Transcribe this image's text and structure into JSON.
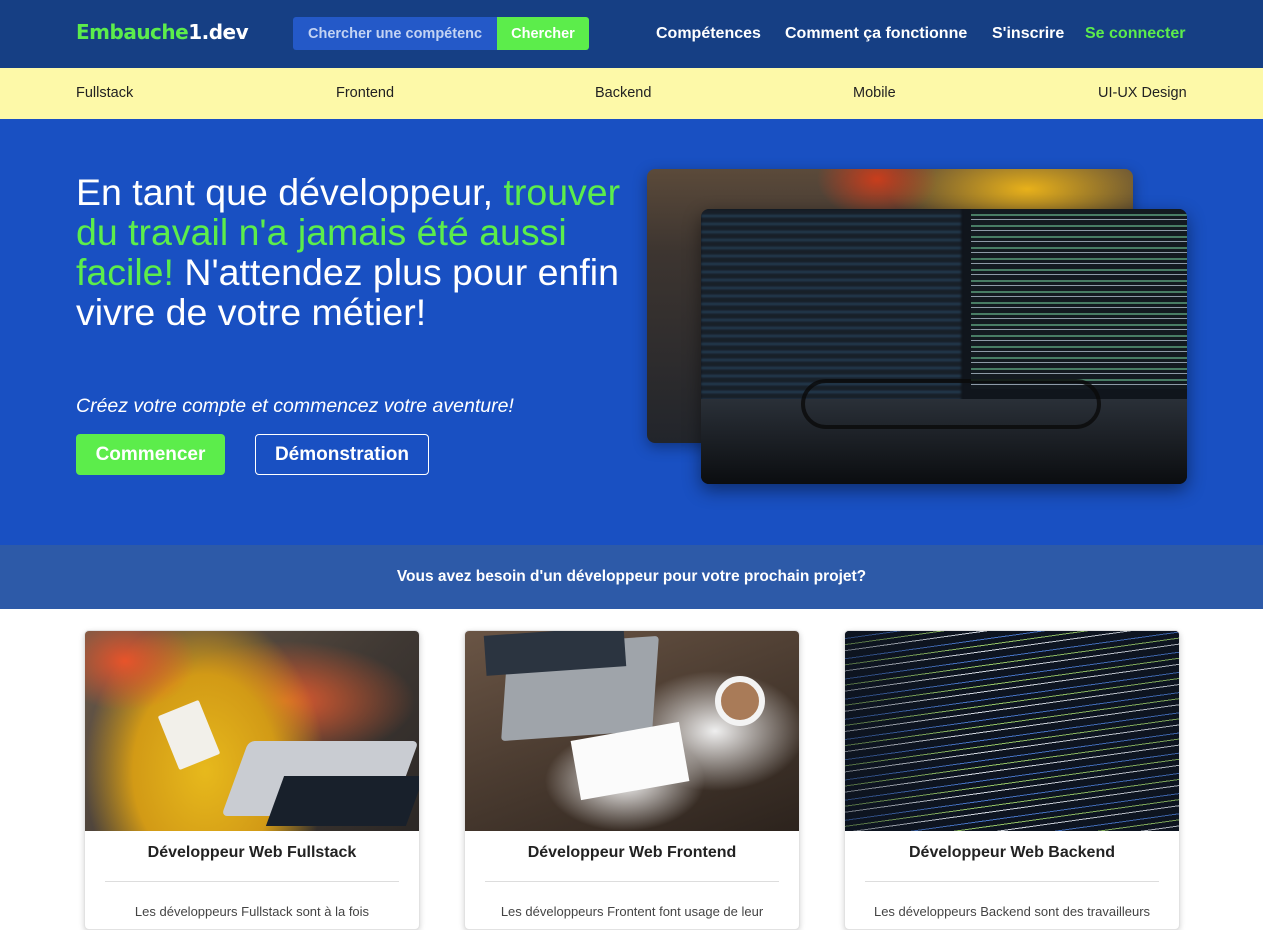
{
  "navbar": {
    "logo_part1": "Embauche",
    "logo_part2": "1.dev",
    "search_placeholder": "Chercher une compétence",
    "search_button": "Chercher",
    "links": {
      "competences": "Compétences",
      "how_it_works": "Comment ça fonctionne",
      "signup": "S'inscrire",
      "login": "Se connecter"
    }
  },
  "categories": [
    "Fullstack",
    "Frontend",
    "Backend",
    "Mobile",
    "UI-UX Design"
  ],
  "hero": {
    "title_line1": "En tant que développeur,",
    "title_highlight": "trouver du travail n'a jamais été aussi facile!",
    "title_rest": "N'attendez plus pour enfin vivre de votre métier!",
    "subtitle": "Créez votre compte et commencez votre aventure!",
    "start_button": "Commencer",
    "demo_button": "Démonstration"
  },
  "banner": {
    "text": "Vous avez besoin d'un développeur pour votre prochain projet?"
  },
  "cards": [
    {
      "title": "Développeur Web Fullstack",
      "text": "Les développeurs Fullstack sont à la fois"
    },
    {
      "title": "Développeur Web Frontend",
      "text": "Les développeurs Frontent font usage de leur"
    },
    {
      "title": "Développeur Web Backend",
      "text": "Les développeurs Backend sont des travailleurs"
    }
  ],
  "colors": {
    "navbar": "#163f84",
    "accent_green": "#5ced4b",
    "category_bar": "#fdf9a8",
    "hero": "#1950c2",
    "banner": "#2d5aa8"
  }
}
